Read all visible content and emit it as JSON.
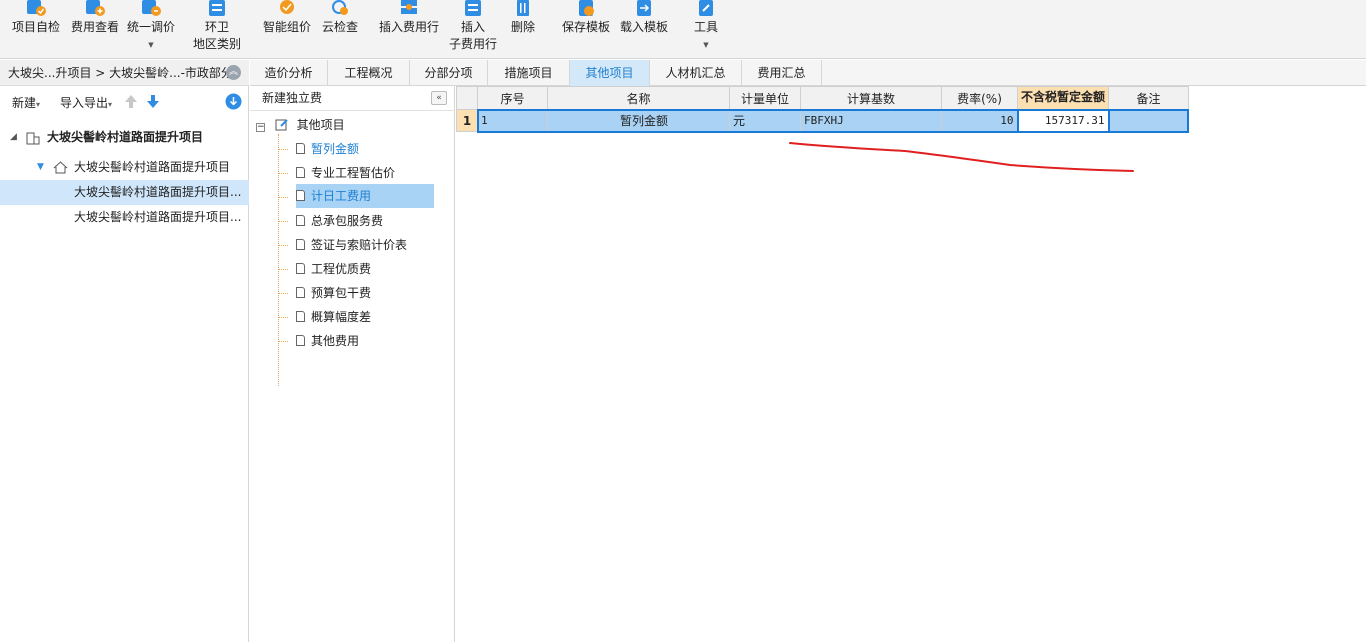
{
  "toolbar": {
    "items": [
      {
        "label": "项目自检",
        "icon": "check-circle-icon"
      },
      {
        "label": "费用查看",
        "icon": "view-cost-icon"
      },
      {
        "label": "统一调价",
        "icon": "adjust-price-icon"
      },
      {
        "label": "环卫",
        "label2": "地区类别",
        "icon": "area-category-icon"
      },
      {
        "label": "智能组价",
        "icon": "smart-pricing-icon"
      },
      {
        "label": "云检查",
        "icon": "cloud-check-icon"
      },
      {
        "label": "插入费用行",
        "icon": "insert-row-icon"
      },
      {
        "label": "插入",
        "label2": "子费用行",
        "icon": "insert-subrow-icon"
      },
      {
        "label": "删除",
        "icon": "delete-icon"
      },
      {
        "label": "保存模板",
        "icon": "save-template-icon"
      },
      {
        "label": "载入模板",
        "icon": "load-template-icon"
      },
      {
        "label": "工具",
        "icon": "tools-icon"
      }
    ]
  },
  "breadcrumb": {
    "text": "大坡尖...升项目 > 大坡尖髻岭...-市政部分"
  },
  "left_actions": {
    "new_label": "新建",
    "import_export_label": "导入导出"
  },
  "left_tree": {
    "root": "大坡尖髻岭村道路面提升项目",
    "child": "大坡尖髻岭村道路面提升项目",
    "leaf1": "大坡尖髻岭村道路面提升项目...",
    "leaf2": "大坡尖髻岭村道路面提升项目..."
  },
  "tabs": [
    "造价分析",
    "工程概况",
    "分部分项",
    "措施项目",
    "其他项目",
    "人材机汇总",
    "费用汇总"
  ],
  "active_tab": "其他项目",
  "mid_panel": {
    "header": "新建独立费",
    "root": "其他项目",
    "items": [
      "暂列金额",
      "专业工程暂估价",
      "计日工费用",
      "总承包服务费",
      "签证与索赔计价表",
      "工程优质费",
      "预算包干费",
      "概算幅度差",
      "其他费用"
    ]
  },
  "grid": {
    "headers": [
      "序号",
      "名称",
      "计量单位",
      "计算基数",
      "费率(%)",
      "不含税暂定金额",
      "备注"
    ],
    "rows": [
      {
        "row_num": "1",
        "seq": "1",
        "name": "暂列金额",
        "unit": "元",
        "base": "FBFXHJ",
        "rate": "10",
        "amount": "157317.31",
        "note": ""
      }
    ]
  },
  "colors": {
    "accent_blue": "#1d7fd1",
    "selection_blue": "#a9d2f4",
    "header_orange": "#fce0b2",
    "annotation_red": "#e02020"
  }
}
